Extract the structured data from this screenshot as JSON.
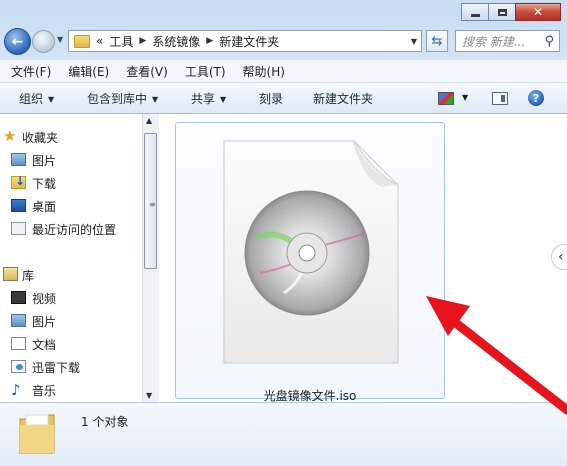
{
  "window": {
    "minimize_label": "Minimize",
    "maximize_label": "Maximize",
    "close_label": "Close"
  },
  "address_bar": {
    "overflow": "«",
    "crumbs": [
      "工具",
      "系统镜像",
      "新建文件夹"
    ]
  },
  "search": {
    "placeholder": "搜索 新建..."
  },
  "menu": [
    "文件(F)",
    "编辑(E)",
    "查看(V)",
    "工具(T)",
    "帮助(H)"
  ],
  "toolbar": {
    "organize": "组织",
    "include_in_library": "包含到库中",
    "share": "共享",
    "burn": "刻录",
    "new_folder": "新建文件夹"
  },
  "nav": {
    "favorites": {
      "label": "收藏夹",
      "items": [
        "图片",
        "下载",
        "桌面",
        "最近访问的位置"
      ]
    },
    "libraries": {
      "label": "库",
      "items": [
        "视频",
        "图片",
        "文档",
        "迅雷下载",
        "音乐"
      ]
    }
  },
  "files": [
    {
      "name": "光盘镜像文件.iso",
      "icon": "disc-image-icon"
    }
  ],
  "status": {
    "count_text": "1 个对象"
  },
  "colors": {
    "accent": "#2c63b8",
    "annotation_arrow": "#e8141c"
  }
}
